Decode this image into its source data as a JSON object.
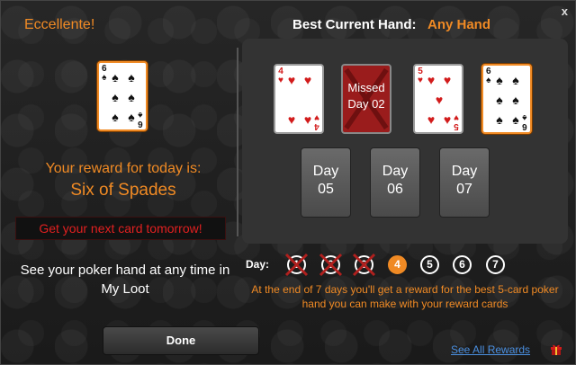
{
  "window": {
    "close_label": "x"
  },
  "left": {
    "congrats": "Eccellente!",
    "reward_card": {
      "rank": "6",
      "suit": "♠",
      "color": "black",
      "highlight_color": "#f08a24"
    },
    "reward_label": "Your reward for today is:",
    "reward_name": "Six of Spades",
    "next_card_notice": "Get your next card tomorrow!",
    "see_hand": "See your poker hand at any time in My Loot"
  },
  "right": {
    "best_hand_label": "Best Current Hand:",
    "best_hand_value": "Any Hand",
    "cards": [
      {
        "type": "card",
        "rank": "4",
        "suit": "♥",
        "color": "red",
        "highlight": false
      },
      {
        "type": "missed",
        "line1": "Missed",
        "line2": "Day 02"
      },
      {
        "type": "card",
        "rank": "5",
        "suit": "♥",
        "color": "red",
        "highlight": false
      },
      {
        "type": "card",
        "rank": "6",
        "suit": "♠",
        "color": "black",
        "highlight": true
      }
    ],
    "pending_days": [
      {
        "line1": "Day",
        "line2": "05"
      },
      {
        "line1": "Day",
        "line2": "06"
      },
      {
        "line1": "Day",
        "line2": "07"
      }
    ],
    "day_label": "Day:",
    "day_markers": [
      {
        "num": "1",
        "state": "missed"
      },
      {
        "num": "2",
        "state": "missed"
      },
      {
        "num": "3",
        "state": "missed"
      },
      {
        "num": "4",
        "state": "current"
      },
      {
        "num": "5",
        "state": "upcoming"
      },
      {
        "num": "6",
        "state": "upcoming"
      },
      {
        "num": "7",
        "state": "upcoming"
      }
    ],
    "footnote": "At the end of 7 days you'll get a reward for the best 5-card poker hand you can make with your reward cards"
  },
  "footer": {
    "done_label": "Done",
    "see_all_label": "See All Rewards",
    "gift_icon": "gift-icon"
  },
  "colors": {
    "accent": "#f08a24",
    "alert_red": "#e02020",
    "link_blue": "#4a8fe0",
    "missed_red": "#9a1c1c"
  }
}
